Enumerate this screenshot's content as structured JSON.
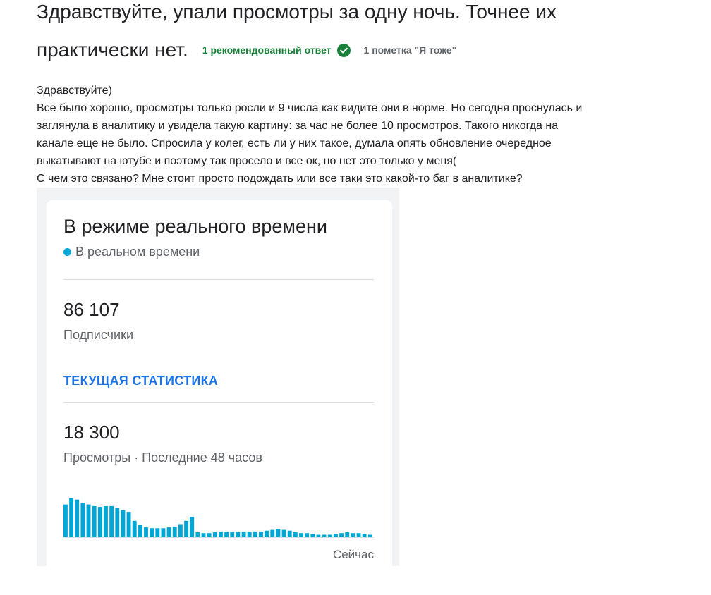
{
  "question": {
    "title_line1": "Здравствуйте, упали просмотры за одну ночь. Точнее их",
    "title_line2": "практически нет.",
    "recommended_answers": "1 рекомендованный ответ",
    "me_too": "1 пометка \"Я тоже\""
  },
  "body_lines": [
    "Здравствуйте)",
    "Все было хорошо, просмотры только росли и 9 числа как видите они в норме. Но сегодня проснулась и",
    "заглянула в аналитику и увидела такую картину: за час не более 10 просмотров. Такого никогда на",
    "канале еще не было. Спросила у колег, есть ли у них такое, думала опять обновление очередное",
    "выкатывают на ютубе и поэтому так просело и все ок, но нет это только у меня(",
    "С чем это связано? Мне стоит просто подождать или все таки это какой-то баг в аналитике?"
  ],
  "card": {
    "title": "В режиме реального времени",
    "live_label": "В реальном времени",
    "subscribers_value": "86 107",
    "subscribers_label": "Подписчики",
    "stats_link": "ТЕКУЩАЯ СТАТИСТИКА",
    "views_value": "18 300",
    "views_label": "Просмотры · Последние 48 часов",
    "chart_now_label": "Сейчас"
  },
  "colors": {
    "accent_green": "#188038",
    "link_blue": "#1a73e8",
    "bar_blue": "#00a6d6"
  },
  "chart_data": {
    "type": "bar",
    "title": "",
    "xlabel": "Сейчас",
    "ylabel": "",
    "values": [
      40,
      48,
      46,
      42,
      40,
      38,
      37,
      38,
      38,
      36,
      33,
      31,
      20,
      15,
      12,
      11,
      11,
      11,
      12,
      13,
      16,
      20,
      25,
      6,
      5,
      5,
      6,
      7,
      6,
      6,
      6,
      6,
      6,
      7,
      7,
      8,
      9,
      10,
      9,
      8,
      6,
      5,
      5,
      4,
      3,
      3,
      3,
      4,
      5,
      6,
      5,
      5,
      4,
      3
    ]
  }
}
